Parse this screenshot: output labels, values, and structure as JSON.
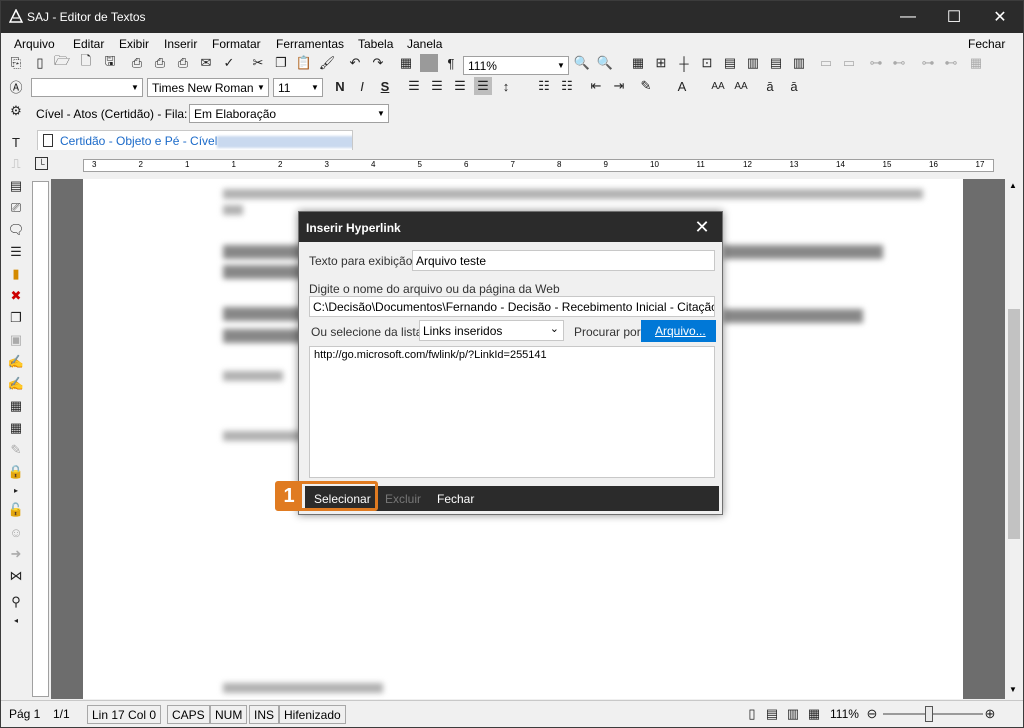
{
  "window": {
    "title": "SAJ - Editor de Textos",
    "minimize": "—",
    "maximize": "☐",
    "close": "✕"
  },
  "menu": {
    "items": [
      "Arquivo",
      "Editar",
      "Exibir",
      "Inserir",
      "Formatar",
      "Ferramentas",
      "Tabela",
      "Janela"
    ],
    "right": "Fechar"
  },
  "toolbar": {
    "zoom": "111%",
    "font_name": "Times New Roman",
    "font_size": "11",
    "bold": "N",
    "italic": "I",
    "underline": "S",
    "strike": "S"
  },
  "queue": {
    "label": "Cível - Atos (Certidão) - Fila:",
    "value": "Em Elaboração"
  },
  "document_tab": {
    "label": "Certidão - Objeto e Pé - Cível"
  },
  "dialog": {
    "title": "Inserir Hyperlink",
    "display_text_label": "Texto para exibição",
    "display_text_value": "Arquivo teste",
    "path_label": "Digite o nome do arquivo ou da página da Web",
    "path_value": "C:\\Decisão\\Documentos\\Fernando - Decisão - Recebimento Inicial - Citação elet",
    "list_label": "Ou selecione da lista",
    "list_value": "Links inseridos",
    "browse_label": "Procurar por",
    "browse_button": "Arquivo...",
    "link_item": "http://go.microsoft.com/fwlink/p/?LinkId=255141",
    "select_button": "Selecionar",
    "delete_button": "Excluir",
    "close_button": "Fechar"
  },
  "callout": {
    "number": "1",
    "color": "#e07b21"
  },
  "ruler": {
    "marks": [
      "3",
      "2",
      "1",
      "1",
      "2",
      "3",
      "4",
      "5",
      "6",
      "7",
      "8",
      "9",
      "10",
      "11",
      "12",
      "13",
      "14",
      "15",
      "16",
      "17"
    ]
  },
  "status": {
    "page": "Pág 1",
    "pages": "1/1",
    "position": "Lin 17  Col 0",
    "caps": "CAPS",
    "num": "NUM",
    "ins": "INS",
    "hyphen": "Hifenizado",
    "zoom": "111%"
  },
  "colors": {
    "titlebar": "#2b2b2b",
    "accent": "#0078d7",
    "tab_text": "#1b6ac9"
  }
}
